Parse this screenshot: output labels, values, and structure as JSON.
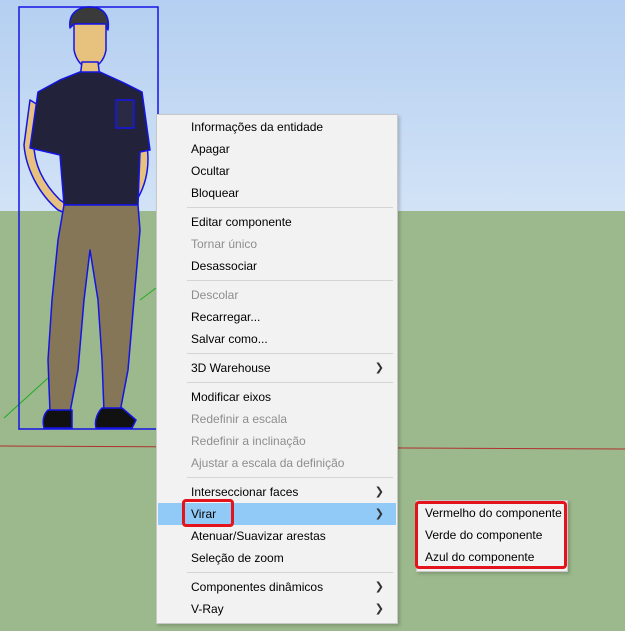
{
  "colors": {
    "sky": "#b4cff1",
    "ground": "#9bb98c",
    "menu_background": "#f2f2f2",
    "menu_highlight": "#91c9f7",
    "disabled_text": "#8e8e8e",
    "selection_blue": "#1414e6",
    "callout_red": "#e3141c"
  },
  "context_menu": {
    "groups": [
      [
        {
          "label": "Informações da entidade",
          "enabled": true
        },
        {
          "label": "Apagar",
          "enabled": true
        },
        {
          "label": "Ocultar",
          "enabled": true
        },
        {
          "label": "Bloquear",
          "enabled": true
        }
      ],
      [
        {
          "label": "Editar componente",
          "enabled": true
        },
        {
          "label": "Tornar único",
          "enabled": false
        },
        {
          "label": "Desassociar",
          "enabled": true
        }
      ],
      [
        {
          "label": "Descolar",
          "enabled": false
        },
        {
          "label": "Recarregar...",
          "enabled": true
        },
        {
          "label": "Salvar como...",
          "enabled": true
        }
      ],
      [
        {
          "label": "3D Warehouse",
          "enabled": true,
          "submenu_icon": "chevron-right-icon"
        }
      ],
      [
        {
          "label": "Modificar eixos",
          "enabled": true
        },
        {
          "label": "Redefinir a escala",
          "enabled": false
        },
        {
          "label": "Redefinir a inclinação",
          "enabled": false
        },
        {
          "label": "Ajustar a escala da definição",
          "enabled": false
        }
      ],
      [
        {
          "label": "Interseccionar faces",
          "enabled": true,
          "submenu_icon": "chevron-right-icon"
        },
        {
          "label": "Virar",
          "enabled": true,
          "highlighted": true,
          "submenu_icon": "chevron-right-icon"
        },
        {
          "label": "Atenuar/Suavizar arestas",
          "enabled": true
        },
        {
          "label": "Seleção de zoom",
          "enabled": true
        }
      ],
      [
        {
          "label": "Componentes dinâmicos",
          "enabled": true,
          "submenu_icon": "chevron-right-icon"
        },
        {
          "label": "V-Ray",
          "enabled": true,
          "submenu_icon": "chevron-right-icon"
        }
      ]
    ]
  },
  "submenu": {
    "items": [
      {
        "label": "Vermelho do componente"
      },
      {
        "label": "Verde do componente"
      },
      {
        "label": "Azul do componente"
      }
    ]
  }
}
